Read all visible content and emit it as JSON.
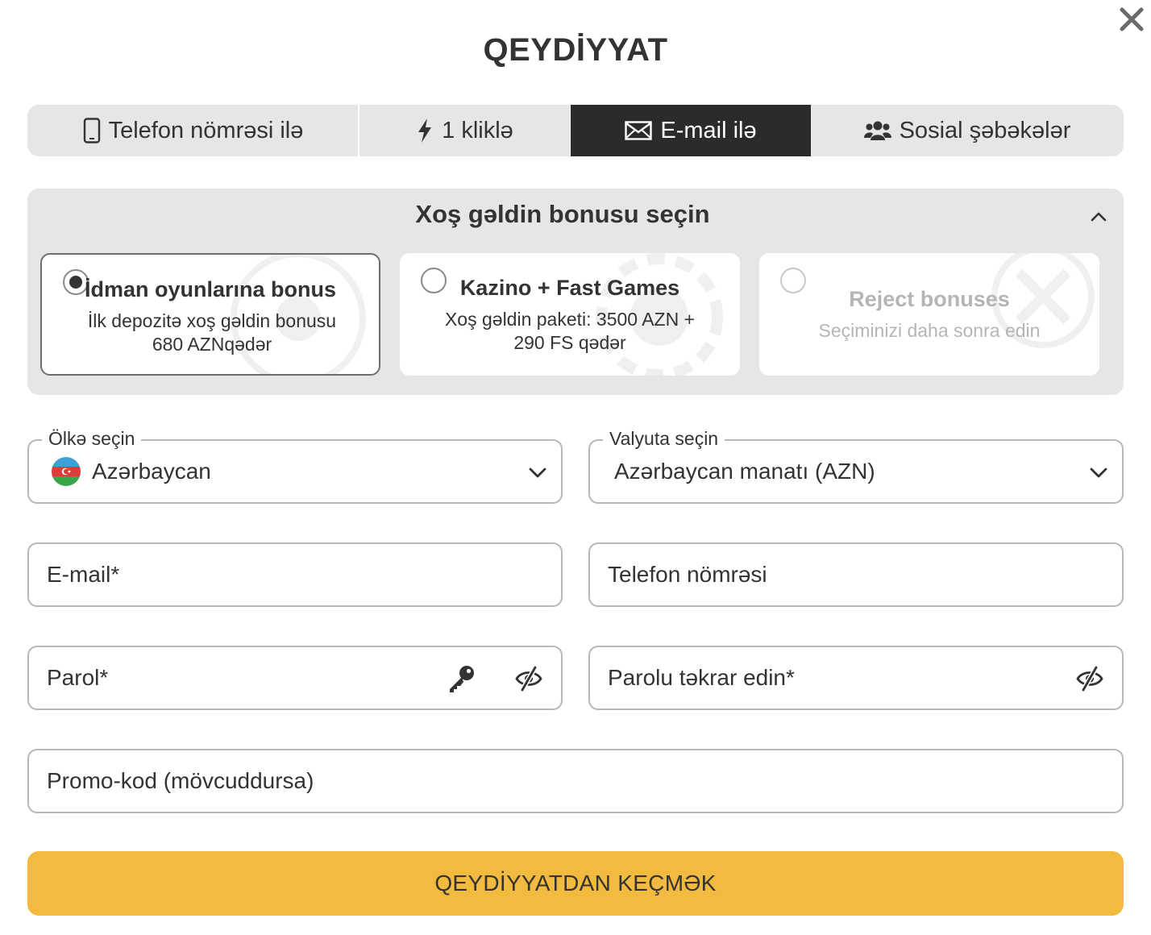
{
  "title": "QEYDİYYAT",
  "tabs": [
    {
      "label": "Telefon nömrəsi ilə",
      "icon": "phone-icon"
    },
    {
      "label": "1 kliklə",
      "icon": "lightning-icon"
    },
    {
      "label": "E-mail ilə",
      "icon": "envelope-icon",
      "active": true
    },
    {
      "label": "Sosial şəbəkələr",
      "icon": "users-icon"
    }
  ],
  "bonus": {
    "title": "Xoş gəldin bonusu seçin",
    "options": [
      {
        "name": "İdman oyunlarına bonus",
        "description": "İlk depozitə xoş gəldin bonusu 680 AZNqədər",
        "selected": true
      },
      {
        "name": "Kazino + Fast Games",
        "description": "Xoş gəldin paketi: 3500 AZN + 290 FS qədər",
        "selected": false
      },
      {
        "name": "Reject bonuses",
        "description": "Seçiminizi daha sonra edin",
        "selected": false
      }
    ]
  },
  "form": {
    "country": {
      "label": "Ölkə seçin",
      "value": "Azərbaycan"
    },
    "currency": {
      "label": "Valyuta seçin",
      "value": "Azərbaycan manatı (AZN)"
    },
    "email": {
      "placeholder": "E-mail*"
    },
    "phone": {
      "placeholder": "Telefon nömrəsi"
    },
    "password": {
      "placeholder": "Parol*"
    },
    "password_repeat": {
      "placeholder": "Parolu təkrar edin*"
    },
    "promo": {
      "placeholder": "Promo-kod (mövcuddursa)"
    }
  },
  "submit_label": "QEYDİYYATDAN KEÇMƏK",
  "colors": {
    "accent": "#f2bb3f",
    "active_tab": "#2b2b2b",
    "panel": "#e6e6e6",
    "text": "#333333"
  }
}
